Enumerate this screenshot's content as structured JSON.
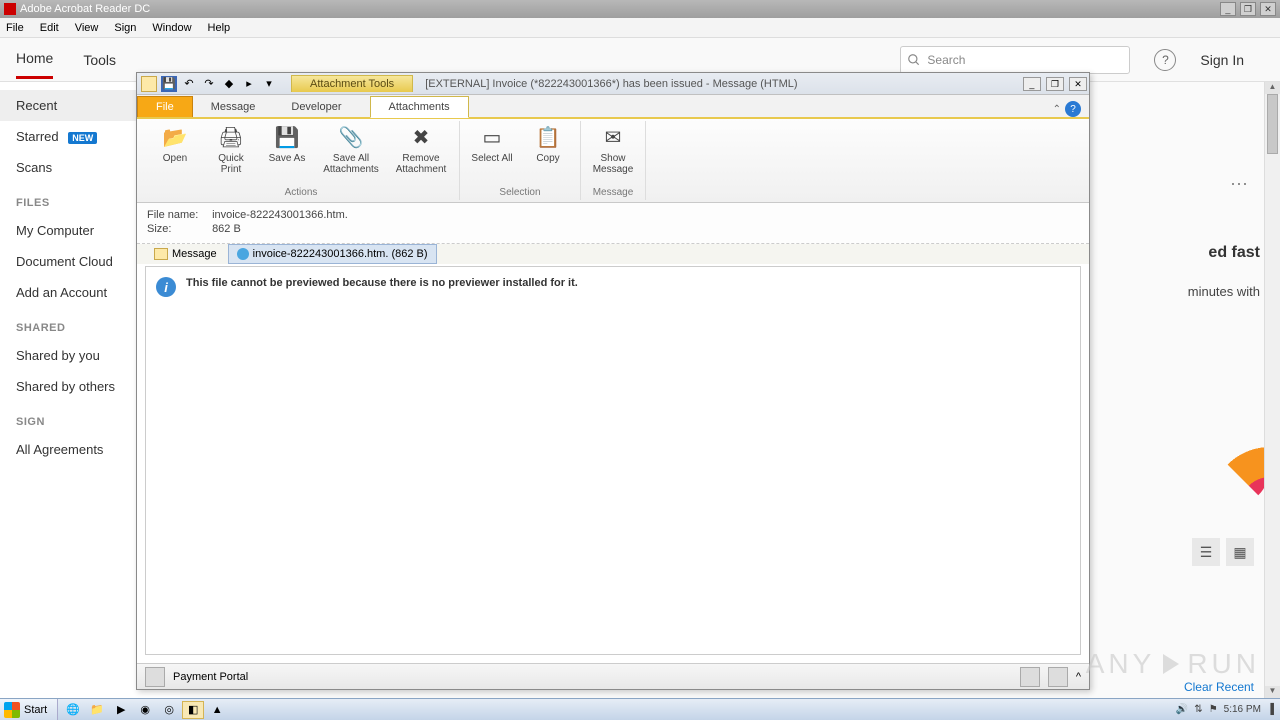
{
  "acrobat": {
    "title": "Adobe Acrobat Reader DC",
    "menu": [
      "File",
      "Edit",
      "View",
      "Sign",
      "Window",
      "Help"
    ],
    "tabs": {
      "home": "Home",
      "tools": "Tools"
    },
    "search_placeholder": "Search",
    "signin": "Sign In",
    "sidebar": {
      "recent": "Recent",
      "starred": "Starred",
      "new_badge": "NEW",
      "scans": "Scans",
      "files_head": "FILES",
      "my_computer": "My Computer",
      "doc_cloud": "Document Cloud",
      "add_account": "Add an Account",
      "shared_head": "SHARED",
      "shared_by_you": "Shared by you",
      "shared_by_others": "Shared by others",
      "sign_head": "SIGN",
      "all_agreements": "All Agreements"
    },
    "peek1": "ed fast",
    "peek2": "minutes with",
    "clear_recent": "Clear Recent"
  },
  "outlook": {
    "attachment_tools": "Attachment Tools",
    "window_title": "[EXTERNAL] Invoice (*822243001366*) has been issued - Message (HTML)",
    "tabs": {
      "file": "File",
      "message": "Message",
      "developer": "Developer",
      "attachments": "Attachments"
    },
    "ribbon": {
      "open": "Open",
      "quick_print": "Quick Print",
      "save_as": "Save As",
      "save_all": "Save All Attachments",
      "remove": "Remove Attachment",
      "select_all": "Select All",
      "copy": "Copy",
      "show_msg": "Show Message",
      "grp_actions": "Actions",
      "grp_selection": "Selection",
      "grp_message": "Message"
    },
    "fileinfo": {
      "name_label": "File name:",
      "name_value": "invoice-822243001366.htm.",
      "size_label": "Size:",
      "size_value": "862 B"
    },
    "tabs2": {
      "message": "Message",
      "attachment": "invoice-822243001366.htm. (862 B)"
    },
    "preview_msg": "This file cannot be previewed because there is no previewer installed for it.",
    "sender": "Payment Portal"
  },
  "taskbar": {
    "start": "Start",
    "time": "5:16 PM"
  },
  "watermark": {
    "a": "ANY",
    "b": "RUN"
  }
}
